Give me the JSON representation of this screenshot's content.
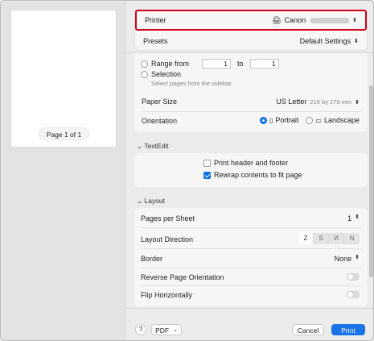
{
  "preview": {
    "page_label": "Page 1 of 1"
  },
  "printer": {
    "label": "Printer",
    "value": "Canon"
  },
  "presets": {
    "label": "Presets",
    "value": "Default Settings"
  },
  "range": {
    "label": "Range from",
    "from": "1",
    "to_label": "to",
    "to": "1"
  },
  "selection": {
    "label": "Selection",
    "hint": "Select pages from the sidebar"
  },
  "paper_size": {
    "label": "Paper Size",
    "value": "US Letter",
    "dims": "216 by 279 mm"
  },
  "orientation": {
    "label": "Orientation",
    "portrait": "Portrait",
    "landscape": "Landscape"
  },
  "textedit": {
    "title": "TextEdit",
    "print_header": "Print header and footer",
    "rewrap": "Rewrap contents to fit page"
  },
  "layout": {
    "title": "Layout",
    "pages_per_sheet_label": "Pages per Sheet",
    "pages_per_sheet_value": "1",
    "direction_label": "Layout Direction",
    "border_label": "Border",
    "border_value": "None",
    "reverse_label": "Reverse Page Orientation",
    "flip_label": "Flip Horizontally"
  },
  "footer": {
    "help": "?",
    "pdf": "PDF",
    "cancel": "Cancel",
    "print": "Print"
  },
  "colors": {
    "accent": "#1a73e8",
    "highlight": "#d0021b"
  }
}
